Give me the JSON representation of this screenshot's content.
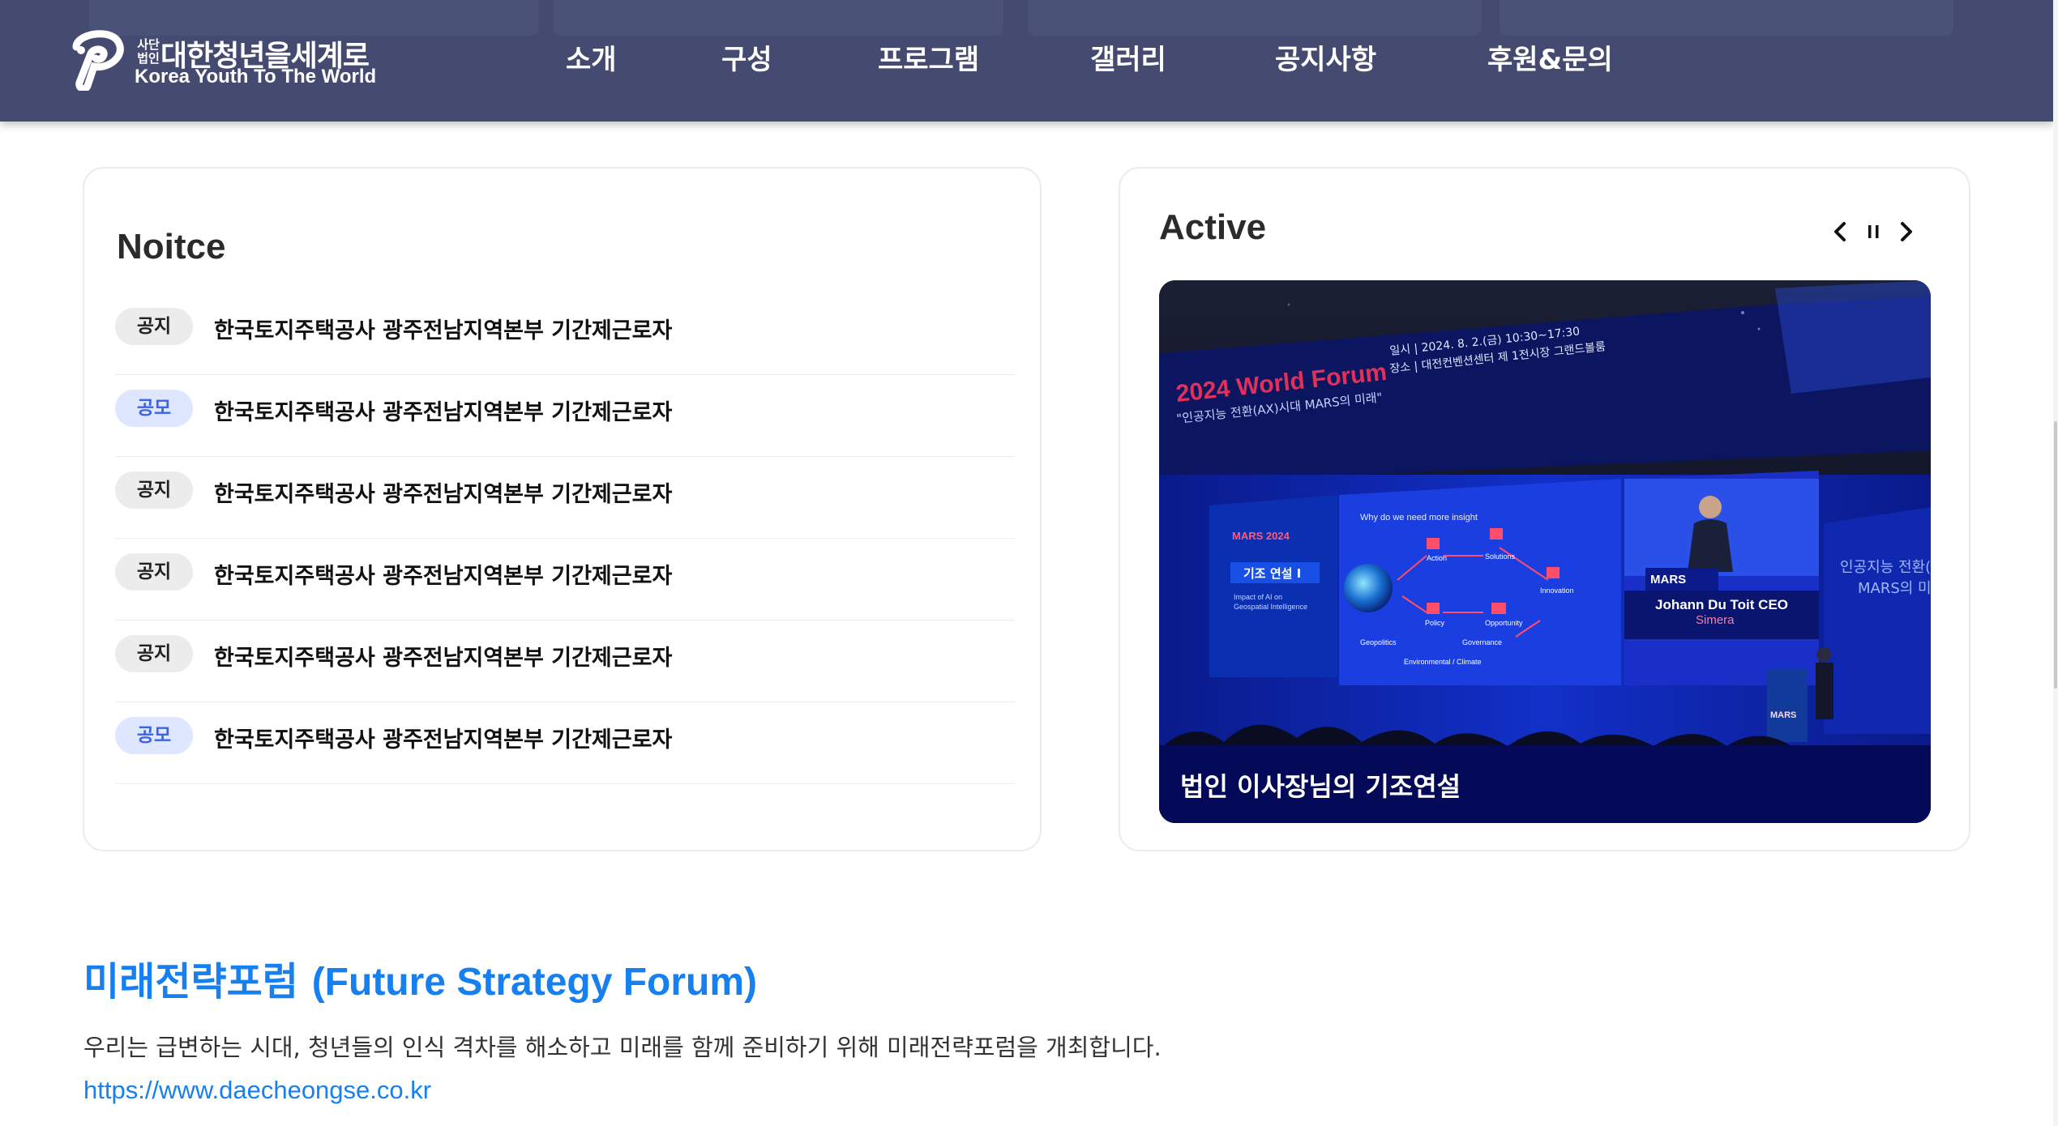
{
  "header": {
    "logo_corp": "사단\n법인",
    "logo_korean": "대한청년을세계로",
    "logo_english": "Korea Youth To The World",
    "nav": [
      "소개",
      "구성",
      "프로그램",
      "갤러리",
      "공지사항",
      "후원&문의"
    ]
  },
  "notice": {
    "title": "Noitce",
    "items": [
      {
        "tag": "공지",
        "title": "한국토지주택공사 광주전남지역본부 기간제근로자"
      },
      {
        "tag": "공모",
        "title": "한국토지주택공사 광주전남지역본부 기간제근로자"
      },
      {
        "tag": "공지",
        "title": "한국토지주택공사 광주전남지역본부 기간제근로자"
      },
      {
        "tag": "공지",
        "title": "한국토지주택공사 광주전남지역본부 기간제근로자"
      },
      {
        "tag": "공지",
        "title": "한국토지주택공사 광주전남지역본부 기간제근로자"
      },
      {
        "tag": "공모",
        "title": "한국토지주택공사 광주전남지역본부 기간제근로자"
      }
    ]
  },
  "active": {
    "title": "Active",
    "controls": {
      "prev": "prev-icon",
      "pause": "pause-icon",
      "next": "next-icon"
    },
    "slide": {
      "caption": "법인 이사장님의 기조연설",
      "banner_title": "2024 World Forum",
      "banner_subtitle": "\"인공지능 전환(AX)시대 MARS의 미래\"",
      "banner_date": "일시 | 2024. 8. 2.(금) 10:30~17:30",
      "banner_place": "장소 | 대전컨벤션센터 제 1전시장 그랜드볼룸",
      "screen_left_title": "기조 연설 I",
      "screen_left_sub": "Impact of AI on Geospatial Intelligence",
      "screen_center_title": "Why do we need more insight",
      "screen_center_labels": [
        "Action",
        "Solutions",
        "Innovation",
        "Policy",
        "Opportunity",
        "Geopolitics",
        "Governance",
        "Environmental / Climate"
      ],
      "screen_right_event": "MARS",
      "screen_right_name": "Johann Du Toit CEO",
      "screen_right_company": "Simera",
      "side_text": "인공지능 전환(AX) MARS의 미"
    }
  },
  "forum": {
    "title_ko": "미래전략포럼",
    "title_en": "(Future Strategy Forum)",
    "description": "우리는 급변하는 시대, 청년들의 인식 격차를 해소하고 미래를 함께 준비하기 위해 미래전략포럼을 개최합니다.",
    "link": "https://www.daecheongse.co.kr"
  },
  "colors": {
    "header_bg": "#454b70",
    "accent_blue": "#1680f0",
    "tag_gray_bg": "#ececec",
    "tag_blue_bg": "#dfe6ff",
    "tag_blue_text": "#3b63e6",
    "caption_bg": "#050a58"
  }
}
